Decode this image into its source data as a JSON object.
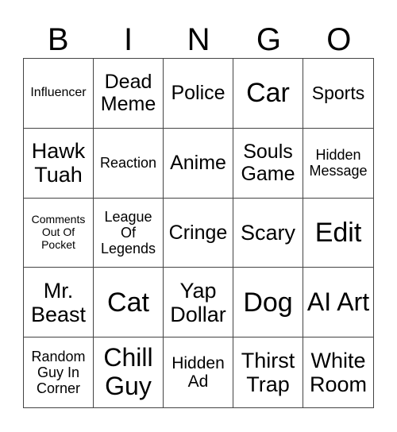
{
  "header": [
    "B",
    "I",
    "N",
    "G",
    "O"
  ],
  "cells": [
    "Influencer",
    "Dead Meme",
    "Police",
    "Car",
    "Sports",
    "Hawk Tuah",
    "Reaction",
    "Anime",
    "Souls Game",
    "Hidden Message",
    "Comments Out Of Pocket",
    "League Of Legends",
    "Cringe",
    "Scary",
    "Edit",
    "Mr. Beast",
    "Cat",
    "Yap Dollar",
    "Dog",
    "AI Art",
    "Random Guy In Corner",
    "Chill Guy",
    "Hidden Ad",
    "Thirst Trap",
    "White Room"
  ]
}
